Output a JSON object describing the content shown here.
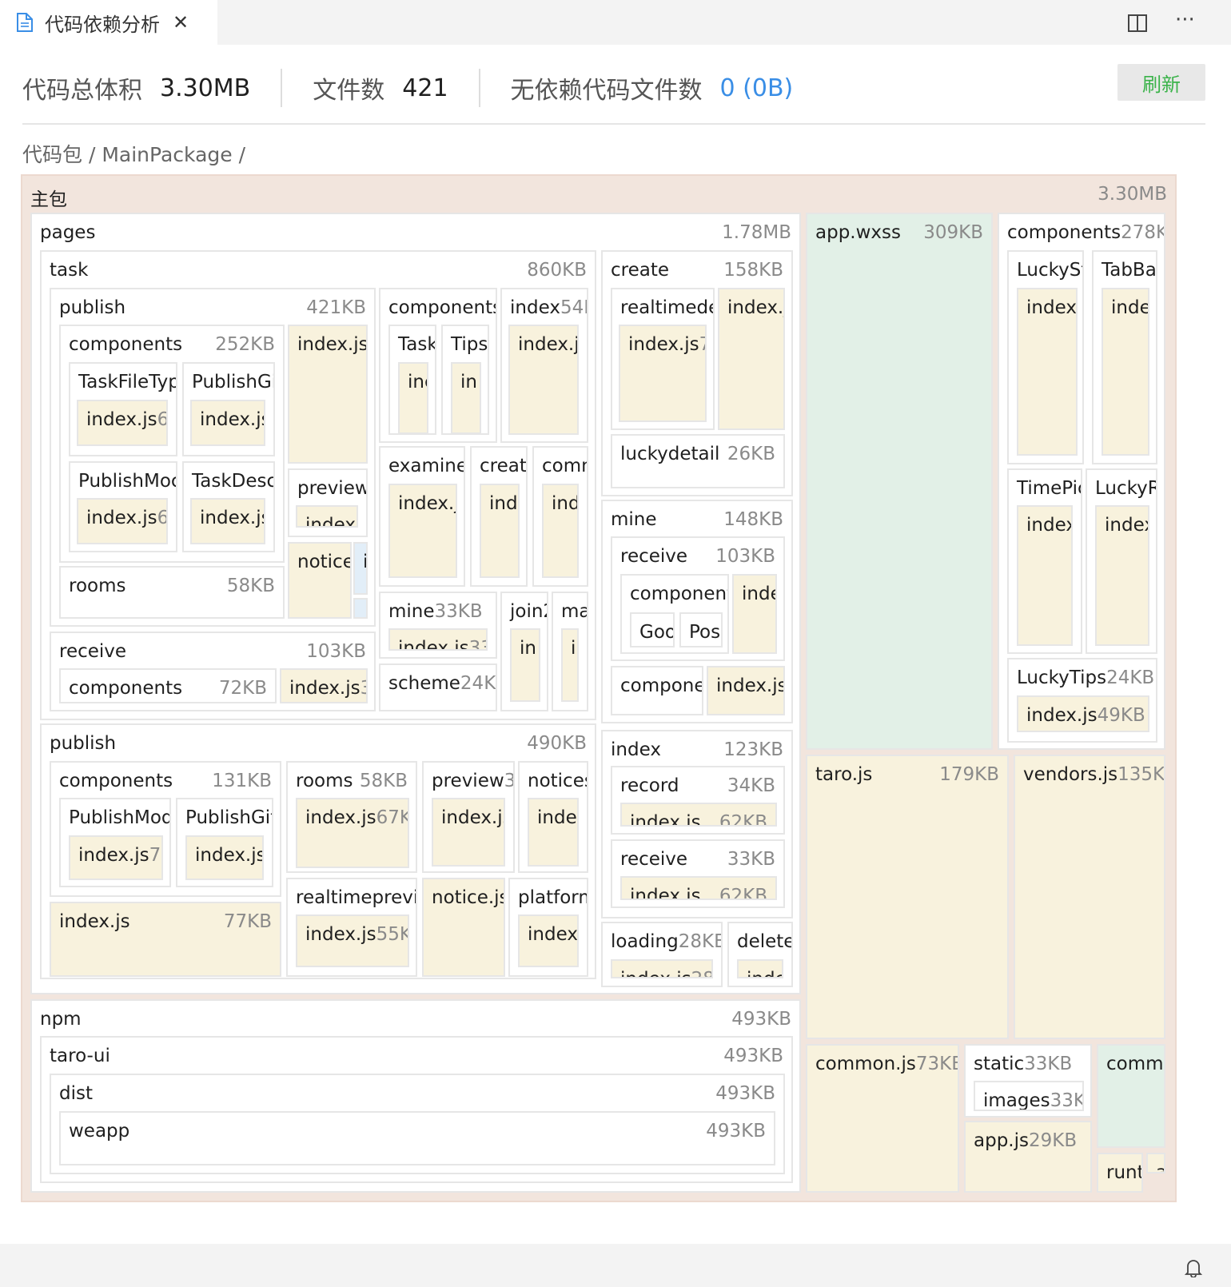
{
  "tab": {
    "title": "代码依赖分析",
    "close": "✕",
    "icon": "file-icon"
  },
  "toolbar": {
    "split_icon": "split-editor-icon",
    "more": "···"
  },
  "stats": {
    "total_label": "代码总体积",
    "total_value": "3.30MB",
    "files_label": "文件数",
    "files_value": "421",
    "nodep_label": "无依赖代码文件数",
    "nodep_value": "0 (0B)"
  },
  "refresh_label": "刷新",
  "breadcrumb": {
    "root": "代码包",
    "sep1": " / ",
    "pkg": "MainPackage",
    "sep2": " /"
  },
  "colors": {
    "leaf": "#f8f2dd",
    "green": "#e2f0e7",
    "blue": "#e2eef8",
    "root": "#f2e5dd",
    "accent": "#3a8ee6",
    "refresh": "#3bb34a"
  },
  "treemap": {
    "root": {
      "name": "主包",
      "size": "3.30MB"
    },
    "pages": {
      "name": "pages",
      "size": "1.78MB"
    },
    "task": {
      "name": "task",
      "size": "860KB"
    },
    "task_publish": {
      "name": "publish",
      "size": "421KB"
    },
    "tp_components": {
      "name": "components",
      "size": "252KB"
    },
    "tp_taskfiletype": {
      "name": "TaskFileTyp"
    },
    "tp_taskfiletype_index": {
      "name": "index.js",
      "size": "6!"
    },
    "tp_publishgift": {
      "name": "PublishGi"
    },
    "tp_publishgift_index": {
      "name": "index.js"
    },
    "tp_publishmod": {
      "name": "PublishMoc"
    },
    "tp_publishmod_index": {
      "name": "index.js",
      "size": "6!"
    },
    "tp_taskdesc": {
      "name": "TaskDesc"
    },
    "tp_taskdesc_index": {
      "name": "index.js"
    },
    "tp_rooms": {
      "name": "rooms",
      "size": "58KB"
    },
    "tp_index": {
      "name": "index.js"
    },
    "tp_preview": {
      "name": "preview"
    },
    "tp_preview_index": {
      "name": "index"
    },
    "tp_notice": {
      "name": "notice"
    },
    "tp_notice_i": {
      "name": "i"
    },
    "tp_notice_dot": {
      "name": "."
    },
    "task_components": {
      "name": "components"
    },
    "tc_task": {
      "name": "Task"
    },
    "tc_task_in": {
      "name": "inc"
    },
    "tc_tips": {
      "name": "Tips"
    },
    "tc_tips_in": {
      "name": "in"
    },
    "task_index": {
      "name": "index",
      "size": "54K"
    },
    "task_index_js": {
      "name": "index.j"
    },
    "task_examine": {
      "name": "examine"
    },
    "task_examine_index": {
      "name": "index.j"
    },
    "task_create": {
      "name": "create"
    },
    "task_create_index": {
      "name": "inde"
    },
    "task_comm": {
      "name": "comn"
    },
    "task_comm_index": {
      "name": "ind"
    },
    "task_mine": {
      "name": "mine",
      "size": "33KB"
    },
    "task_mine_index": {
      "name": "index.js",
      "size": "33"
    },
    "task_join": {
      "name": "join2"
    },
    "task_join_index": {
      "name": "in"
    },
    "task_ma": {
      "name": "ma"
    },
    "task_ma_index": {
      "name": "ii"
    },
    "task_receive": {
      "name": "receive",
      "size": "103KB"
    },
    "tr_components": {
      "name": "components",
      "size": "72KB"
    },
    "tr_index": {
      "name": "index.js",
      "size": "3"
    },
    "task_scheme": {
      "name": "scheme",
      "size": "24KE"
    },
    "create": {
      "name": "create",
      "size": "158KB"
    },
    "create_realtime": {
      "name": "realtimede"
    },
    "create_realtime_index": {
      "name": "index.js",
      "size": "7"
    },
    "create_index": {
      "name": "index.j"
    },
    "create_luckydetail": {
      "name": "luckydetail",
      "size": "26KB"
    },
    "mine": {
      "name": "mine",
      "size": "148KB"
    },
    "mine_receive": {
      "name": "receive",
      "size": "103KB"
    },
    "mr_component": {
      "name": "component"
    },
    "mr_goo": {
      "name": "Goo"
    },
    "mr_pos": {
      "name": "Pos"
    },
    "mr_index": {
      "name": "inde"
    },
    "mine_compone": {
      "name": "compone"
    },
    "mine_index": {
      "name": "index.js"
    },
    "publish": {
      "name": "publish",
      "size": "490KB"
    },
    "pub_components": {
      "name": "components",
      "size": "131KB"
    },
    "pub_publishmod": {
      "name": "PublishMod"
    },
    "pub_publishmod_index": {
      "name": "index.js",
      "size": "73"
    },
    "pub_publishgift": {
      "name": "PublishGit"
    },
    "pub_publishgift_index": {
      "name": "index.js"
    },
    "pub_index": {
      "name": "index.js",
      "size": "77KB"
    },
    "pub_rooms": {
      "name": "rooms",
      "size": "58KB"
    },
    "pub_rooms_index": {
      "name": "index.js",
      "size": "67K"
    },
    "pub_preview": {
      "name": "preview",
      "size": "3!"
    },
    "pub_preview_index": {
      "name": "index.js"
    },
    "pub_notices": {
      "name": "notices"
    },
    "pub_notices_index": {
      "name": "index"
    },
    "pub_realtime": {
      "name": "realtimeprevie"
    },
    "pub_realtime_index": {
      "name": "index.js",
      "size": "55K"
    },
    "pub_notice": {
      "name": "notice.js"
    },
    "pub_platform": {
      "name": "platform"
    },
    "pub_platform_index": {
      "name": "index."
    },
    "index": {
      "name": "index",
      "size": "123KB"
    },
    "idx_record": {
      "name": "record",
      "size": "34KB"
    },
    "idx_record_index": {
      "name": "index.js",
      "size": "62KB"
    },
    "idx_receive": {
      "name": "receive",
      "size": "33KB"
    },
    "idx_receive_index": {
      "name": "index.js",
      "size": "62KB"
    },
    "loading": {
      "name": "loading",
      "size": "28KB"
    },
    "loading_index": {
      "name": "index.js",
      "size": "28"
    },
    "delete": {
      "name": "delete"
    },
    "delete_index": {
      "name": "index"
    },
    "npm": {
      "name": "npm",
      "size": "493KB"
    },
    "taroui": {
      "name": "taro-ui",
      "size": "493KB"
    },
    "dist": {
      "name": "dist",
      "size": "493KB"
    },
    "weapp": {
      "name": "weapp",
      "size": "493KB"
    },
    "appwxss": {
      "name": "app.wxss",
      "size": "309KB"
    },
    "rcomponents": {
      "name": "components",
      "size": "278KE"
    },
    "rc_luckystep": {
      "name": "LuckySt"
    },
    "rc_luckystep_index": {
      "name": "index."
    },
    "rc_tabbar": {
      "name": "TabBa"
    },
    "rc_tabbar_index": {
      "name": "inde"
    },
    "rc_timepick": {
      "name": "TimePic"
    },
    "rc_timepick_index": {
      "name": "index"
    },
    "rc_luckyr": {
      "name": "LuckyR"
    },
    "rc_luckyr_index": {
      "name": "index"
    },
    "rc_luckytips": {
      "name": "LuckyTips",
      "size": "24KB"
    },
    "rc_luckytips_index": {
      "name": "index.js",
      "size": "49KB"
    },
    "tarojs": {
      "name": "taro.js",
      "size": "179KB"
    },
    "vendors": {
      "name": "vendors.js",
      "size": "135KE"
    },
    "commonjs": {
      "name": "common.js",
      "size": "73KB"
    },
    "static": {
      "name": "static",
      "size": "33KB"
    },
    "static_images": {
      "name": "images",
      "size": "33KI"
    },
    "appjs": {
      "name": "app.js",
      "size": "29KB"
    },
    "comm2": {
      "name": "comm"
    },
    "runt": {
      "name": "runt"
    },
    "a": {
      "name": "a"
    }
  }
}
